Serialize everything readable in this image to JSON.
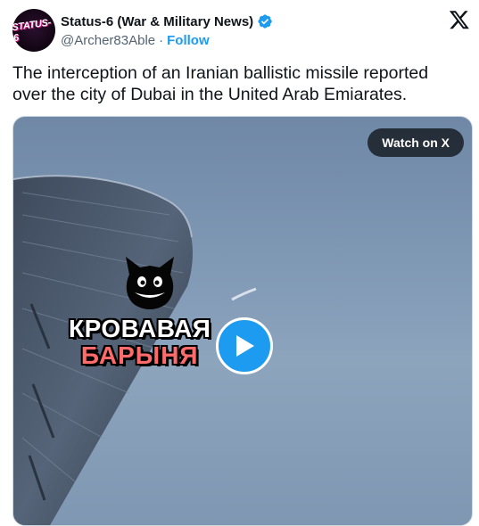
{
  "author": {
    "display_name": "Status-6 (War & Military News)",
    "handle": "@Archer83Able",
    "separator": "·",
    "follow_label": "Follow",
    "avatar_text": "STATUS-6"
  },
  "tweet": {
    "text": "The interception of an Iranian ballistic missile reported over the city of Dubai in the United Arab Emiarates."
  },
  "media": {
    "watch_label": "Watch on X",
    "watermark_line1": "КРОВАВАЯ",
    "watermark_line2": "БАРЫНЯ"
  },
  "colors": {
    "accent": "#1d9bf0",
    "text_primary": "#0f1419",
    "text_secondary": "#536471"
  },
  "icons": {
    "verified": "verified-badge-icon",
    "brand": "x-logo-icon",
    "play": "play-icon"
  }
}
